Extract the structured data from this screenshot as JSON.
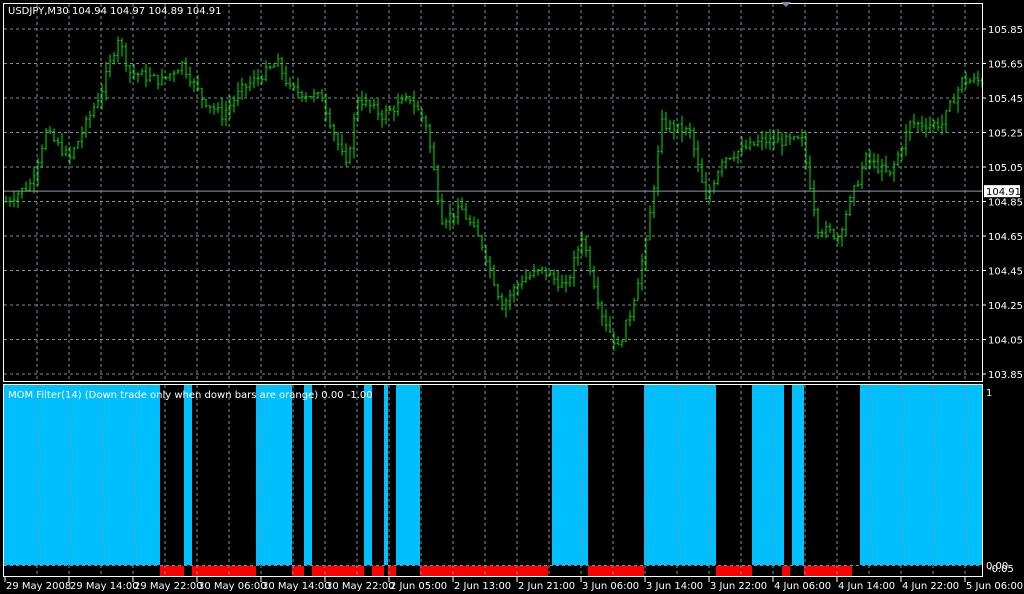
{
  "symbol_info": {
    "label": "USDJPY,M30",
    "ohlc": "104.94 104.97 104.89 104.91"
  },
  "current_price": {
    "value": 104.91,
    "label": "104.91"
  },
  "colors": {
    "bull": "#00e000",
    "cyan": "#00bfff",
    "red": "#ff0000",
    "grid": "#7f8c9a",
    "frame": "#ffffff"
  },
  "price_axis": {
    "min": 103.85,
    "max": 105.85,
    "labels": [
      "105.85",
      "105.65",
      "105.45",
      "105.25",
      "105.05",
      "104.85",
      "104.65",
      "104.45",
      "104.25",
      "104.05",
      "103.85"
    ]
  },
  "price_path": [
    [
      0,
      104.85
    ],
    [
      6,
      104.95
    ],
    [
      10,
      105.25
    ],
    [
      16,
      105.1
    ],
    [
      20,
      105.3
    ],
    [
      24,
      105.5
    ],
    [
      28,
      105.8
    ],
    [
      31,
      105.6
    ],
    [
      39,
      105.55
    ],
    [
      44,
      105.65
    ],
    [
      49,
      105.45
    ],
    [
      54,
      105.35
    ],
    [
      59,
      105.5
    ],
    [
      68,
      105.65
    ],
    [
      71,
      105.5
    ],
    [
      79,
      105.45
    ],
    [
      85,
      105.05
    ],
    [
      88,
      105.45
    ],
    [
      94,
      105.35
    ],
    [
      101,
      105.45
    ],
    [
      105,
      105.3
    ],
    [
      109,
      104.75
    ],
    [
      114,
      104.8
    ],
    [
      119,
      104.6
    ],
    [
      124,
      104.25
    ],
    [
      129,
      104.4
    ],
    [
      134,
      104.45
    ],
    [
      140,
      104.35
    ],
    [
      144,
      104.65
    ],
    [
      149,
      104.2
    ],
    [
      153,
      104.0
    ],
    [
      156,
      104.2
    ],
    [
      160,
      104.6
    ],
    [
      164,
      105.3
    ],
    [
      171,
      105.25
    ],
    [
      175,
      104.85
    ],
    [
      179,
      105.1
    ],
    [
      189,
      105.2
    ],
    [
      199,
      105.2
    ],
    [
      203,
      104.7
    ],
    [
      208,
      104.65
    ],
    [
      211,
      104.85
    ],
    [
      215,
      105.1
    ],
    [
      221,
      105.0
    ],
    [
      226,
      105.3
    ],
    [
      234,
      105.3
    ],
    [
      239,
      105.55
    ],
    [
      244,
      105.55
    ]
  ],
  "indicator": {
    "title": "MOM Filter(14)  (Down trade only when down bars are orange) 0.00 -1.00",
    "scale_top": "1",
    "scale_bottom_a": "0.00",
    "scale_bottom_b": "-0.05",
    "cyan_segments": [
      [
        0,
        39
      ],
      [
        45,
        47
      ],
      [
        63,
        72
      ],
      [
        75,
        77
      ],
      [
        90,
        92
      ],
      [
        95,
        96
      ],
      [
        98,
        104
      ],
      [
        137,
        146
      ],
      [
        160,
        178
      ],
      [
        187,
        195
      ],
      [
        197,
        200
      ],
      [
        214,
        245
      ]
    ],
    "red_segments": [
      [
        39,
        45
      ],
      [
        47,
        63
      ],
      [
        72,
        75
      ],
      [
        77,
        90
      ],
      [
        92,
        95
      ],
      [
        96,
        98
      ],
      [
        104,
        136
      ],
      [
        146,
        160
      ],
      [
        178,
        187
      ],
      [
        194.5,
        196.5
      ],
      [
        200,
        212
      ]
    ]
  },
  "time_axis": {
    "labels": [
      "29 May 2008",
      "29 May 14:00",
      "29 May 22:00",
      "30 May 06:00",
      "30 May 14:00",
      "30 May 22:00",
      "2 Jun 05:00",
      "2 Jun 13:00",
      "2 Jun 21:00",
      "3 Jun 06:00",
      "3 Jun 14:00",
      "3 Jun 22:00",
      "4 Jun 06:00",
      "4 Jun 14:00",
      "4 Jun 22:00",
      "5 Jun 06:00"
    ],
    "bars_per_label": 16
  }
}
